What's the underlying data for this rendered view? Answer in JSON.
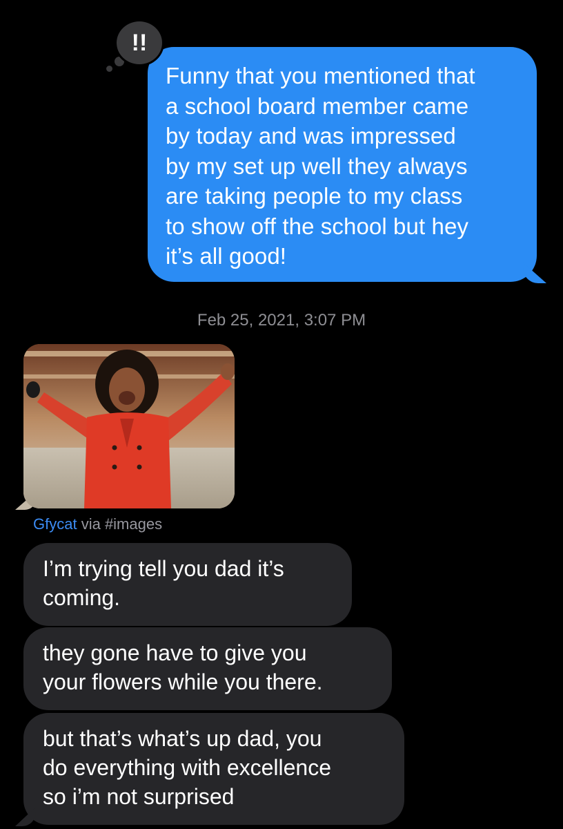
{
  "reaction": {
    "symbol": "!!",
    "icon": "emphasis-reaction-icon"
  },
  "sent_message": {
    "text": "Funny that you mentioned that\na school board member came\nby today and was impressed\nby my set up well they always\nare taking people to my class\nto show off the school but hey\nit’s all good!",
    "color": "#2b8cf4"
  },
  "timestamp": "Feb 25, 2021, 3:07 PM",
  "gif": {
    "icon": "gif-image",
    "source": "Gfycat",
    "via_text": "via #images"
  },
  "received_messages": [
    {
      "text": "I’m trying tell you dad it’s\ncoming."
    },
    {
      "text": "they gone have to give you\nyour flowers while you there."
    },
    {
      "text": "but that’s what’s up dad, you\ndo everything with excellence\nso i’m not surprised"
    }
  ],
  "colors": {
    "background": "#000000",
    "received_bubble": "#262629",
    "timestamp": "#8e8e93",
    "link": "#3c8cf4"
  }
}
